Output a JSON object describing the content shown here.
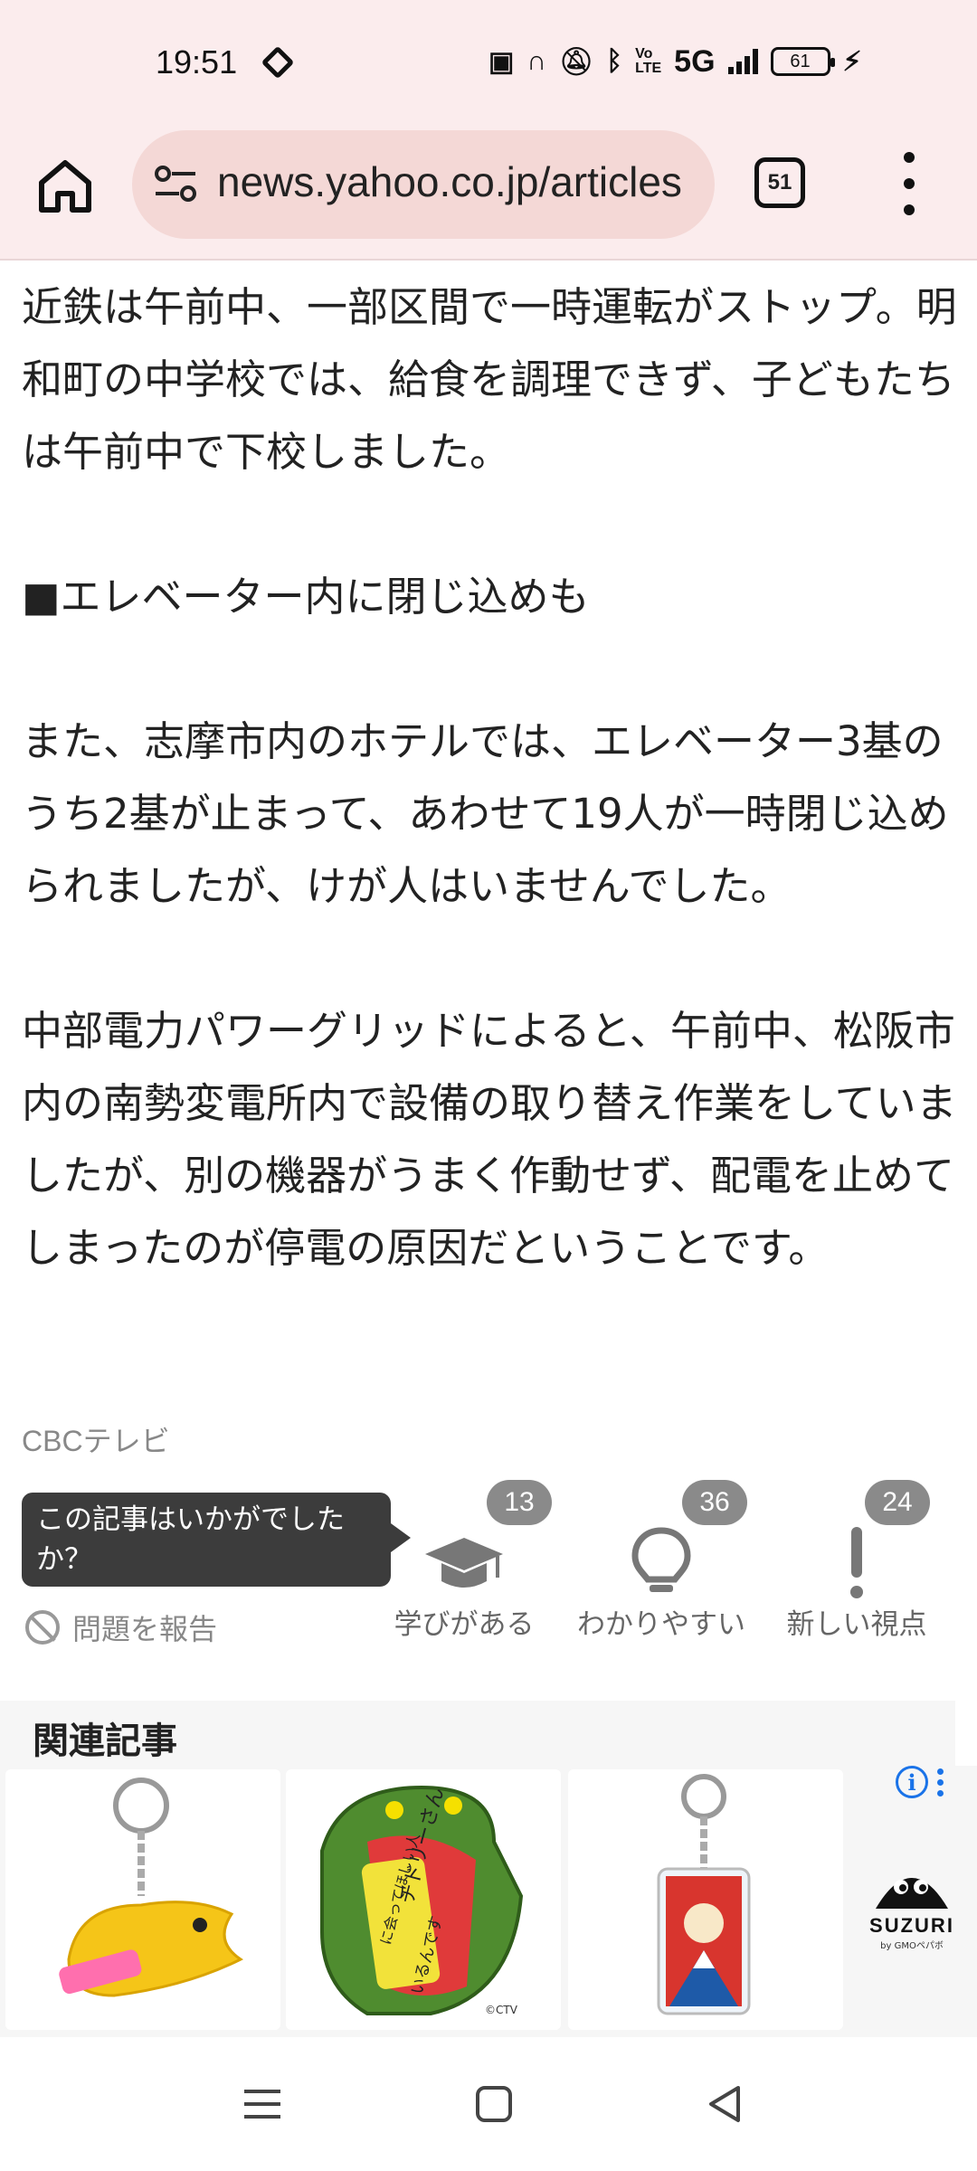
{
  "status_bar": {
    "time": "19:51",
    "network": "5G",
    "battery": "61",
    "icons": [
      "nfc-icon",
      "headphones-icon",
      "mute-icon",
      "bluetooth-icon",
      "volte-icon",
      "signal-icon",
      "battery-icon",
      "charging-icon"
    ]
  },
  "browser": {
    "url": "news.yahoo.co.jp/articles",
    "tab_count": "51"
  },
  "article": {
    "paragraphs": [
      "近鉄は午前中、一部区間で一時運転がストップ。明和町の中学校では、給食を調理できず、子どもたちは午前中で下校しました。",
      "■エレベーター内に閉じ込めも",
      "また、志摩市内のホテルでは、エレベーター3基のうち2基が止まって、あわせて19人が一時閉じ込められましたが、けが人はいませんでした。",
      "中部電力パワーグリッドによると、午前中、松阪市内の南勢変電所内で設備の取り替え作業をしていましたが、別の機器がうまく作動せず、配電を止めてしまったのが停電の原因だということです。"
    ],
    "source": "CBCテレビ"
  },
  "feedback": {
    "prompt": "この記事はいかがでしたか？",
    "report_label": "問題を報告",
    "reactions": [
      {
        "label": "学びがある",
        "count": "13",
        "icon": "graduation-cap-icon"
      },
      {
        "label": "わかりやすい",
        "count": "36",
        "icon": "lightbulb-icon"
      },
      {
        "label": "新しい視点",
        "count": "24",
        "icon": "exclamation-icon"
      }
    ]
  },
  "related": {
    "title": "関連記事"
  },
  "ad": {
    "brand": "SUZURI",
    "brand_sub": "by GMOペパボ",
    "card_texts": [
      "チドリーさん",
      "に会ってほしい人",
      "いるんです",
      "©CTV"
    ]
  },
  "colors": {
    "chrome_bg": "#fbeced",
    "url_pill": "#f4d8d6",
    "badge": "#8a8a8a",
    "link_blue": "#1a73e8"
  }
}
